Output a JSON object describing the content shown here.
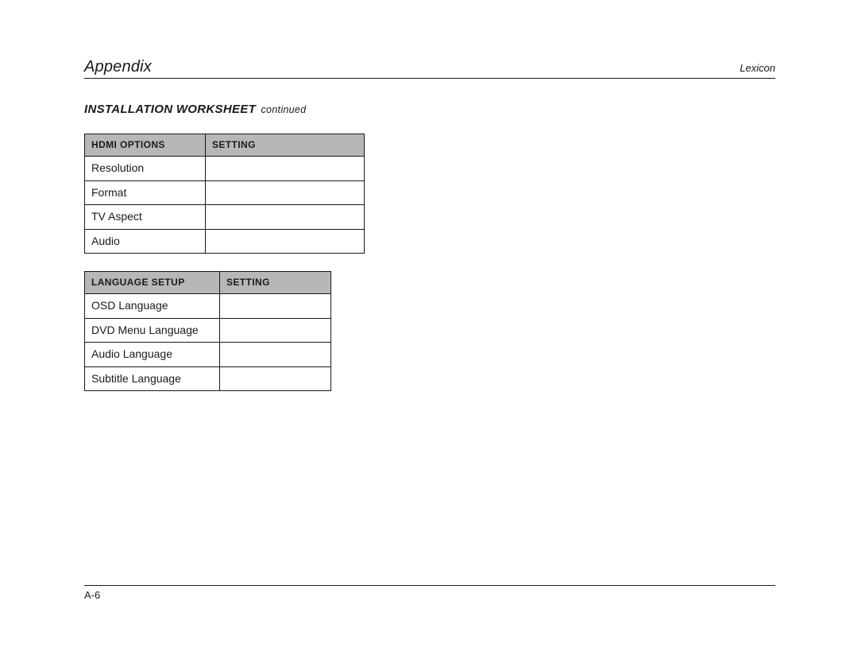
{
  "header": {
    "left": "Appendix",
    "right": "Lexicon"
  },
  "section": {
    "title": "INSTALLATION WORKSHEET",
    "continued": "continued"
  },
  "tables": [
    {
      "headers": [
        "Hdmi Options",
        "Setting"
      ],
      "rows": [
        {
          "label": "Resolution",
          "value": ""
        },
        {
          "label": "Format",
          "value": ""
        },
        {
          "label": "TV Aspect",
          "value": ""
        },
        {
          "label": "Audio",
          "value": ""
        }
      ]
    },
    {
      "headers": [
        "Language Setup",
        "Setting"
      ],
      "rows": [
        {
          "label": "OSD Language",
          "value": ""
        },
        {
          "label": "DVD Menu Language",
          "value": ""
        },
        {
          "label": "Audio Language",
          "value": ""
        },
        {
          "label": "Subtitle Language",
          "value": ""
        }
      ]
    }
  ],
  "footer": {
    "page_number": "A-6"
  }
}
